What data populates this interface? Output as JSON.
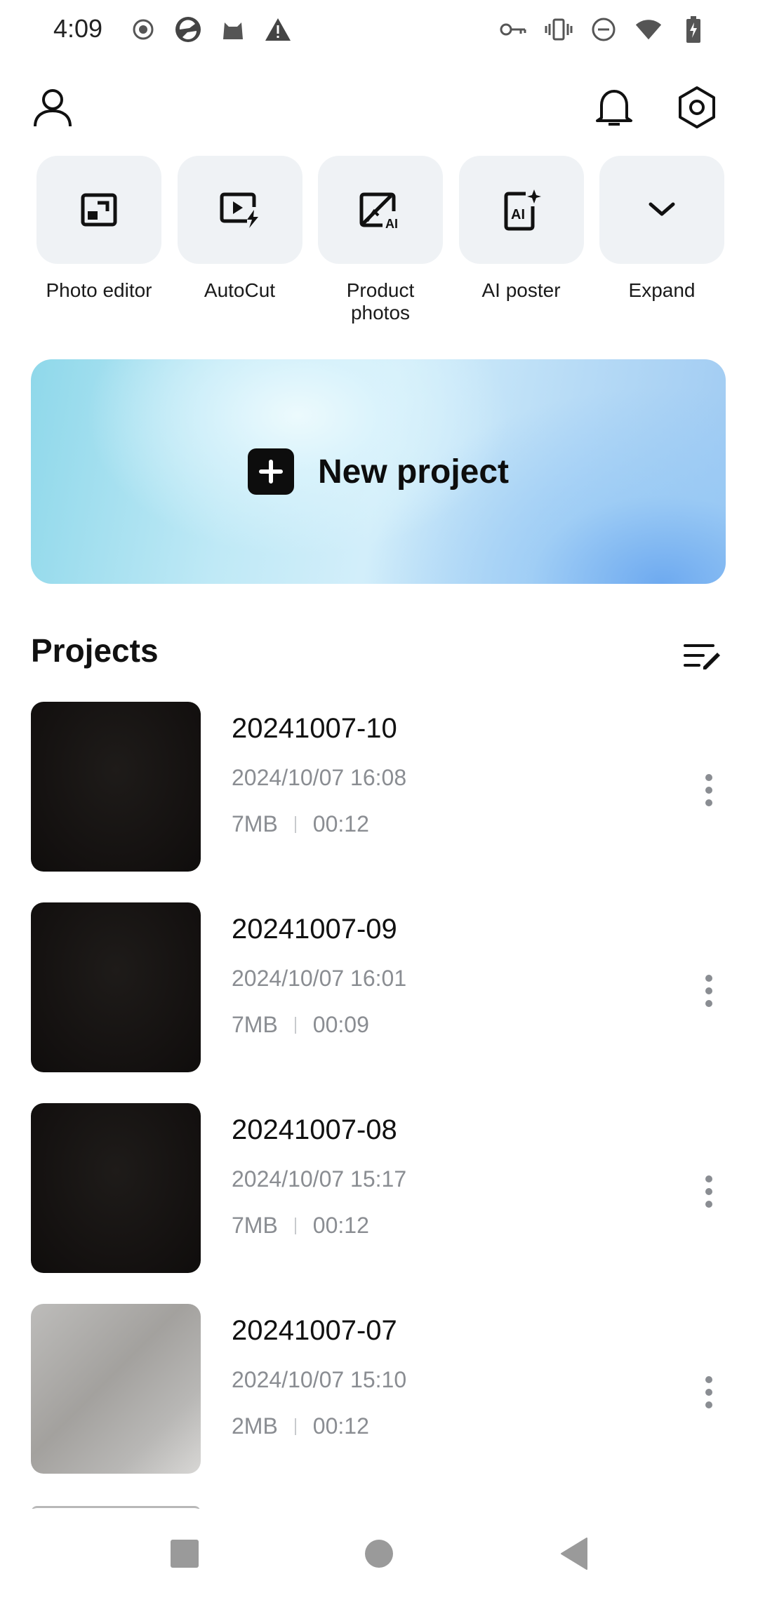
{
  "status_bar": {
    "time": "4:09",
    "left_icons": [
      "record-icon",
      "browser-icon",
      "cat-icon",
      "warning-icon"
    ],
    "right_icons": [
      "vpn-key-icon",
      "vibrate-icon",
      "dnd-icon",
      "wifi-icon",
      "battery-charging-icon"
    ]
  },
  "header": {
    "profile_icon": "person-icon",
    "notifications_icon": "bell-icon",
    "settings_icon": "hexagon-gear-icon"
  },
  "tools": [
    {
      "label": "Photo editor",
      "icon": "photo-edit-icon"
    },
    {
      "label": "AutoCut",
      "icon": "autocut-icon"
    },
    {
      "label": "Product\nphotos",
      "icon": "product-photo-ai-icon"
    },
    {
      "label": "AI poster",
      "icon": "ai-poster-icon"
    },
    {
      "label": "Expand",
      "icon": "chevron-down-icon"
    }
  ],
  "new_project": {
    "label": "New project"
  },
  "projects": {
    "title": "Projects",
    "items": [
      {
        "name": "20241007-10",
        "date": "2024/10/07 16:08",
        "size": "7MB",
        "duration": "00:12"
      },
      {
        "name": "20241007-09",
        "date": "2024/10/07 16:01",
        "size": "7MB",
        "duration": "00:09"
      },
      {
        "name": "20241007-08",
        "date": "2024/10/07 15:17",
        "size": "7MB",
        "duration": "00:12"
      },
      {
        "name": "20241007-07",
        "date": "2024/10/07 15:10",
        "size": "2MB",
        "duration": "00:12"
      }
    ]
  },
  "colors": {
    "tile_bg": "#eff2f5",
    "secondary_text": "#8a8d92",
    "primary_text": "#111111"
  }
}
